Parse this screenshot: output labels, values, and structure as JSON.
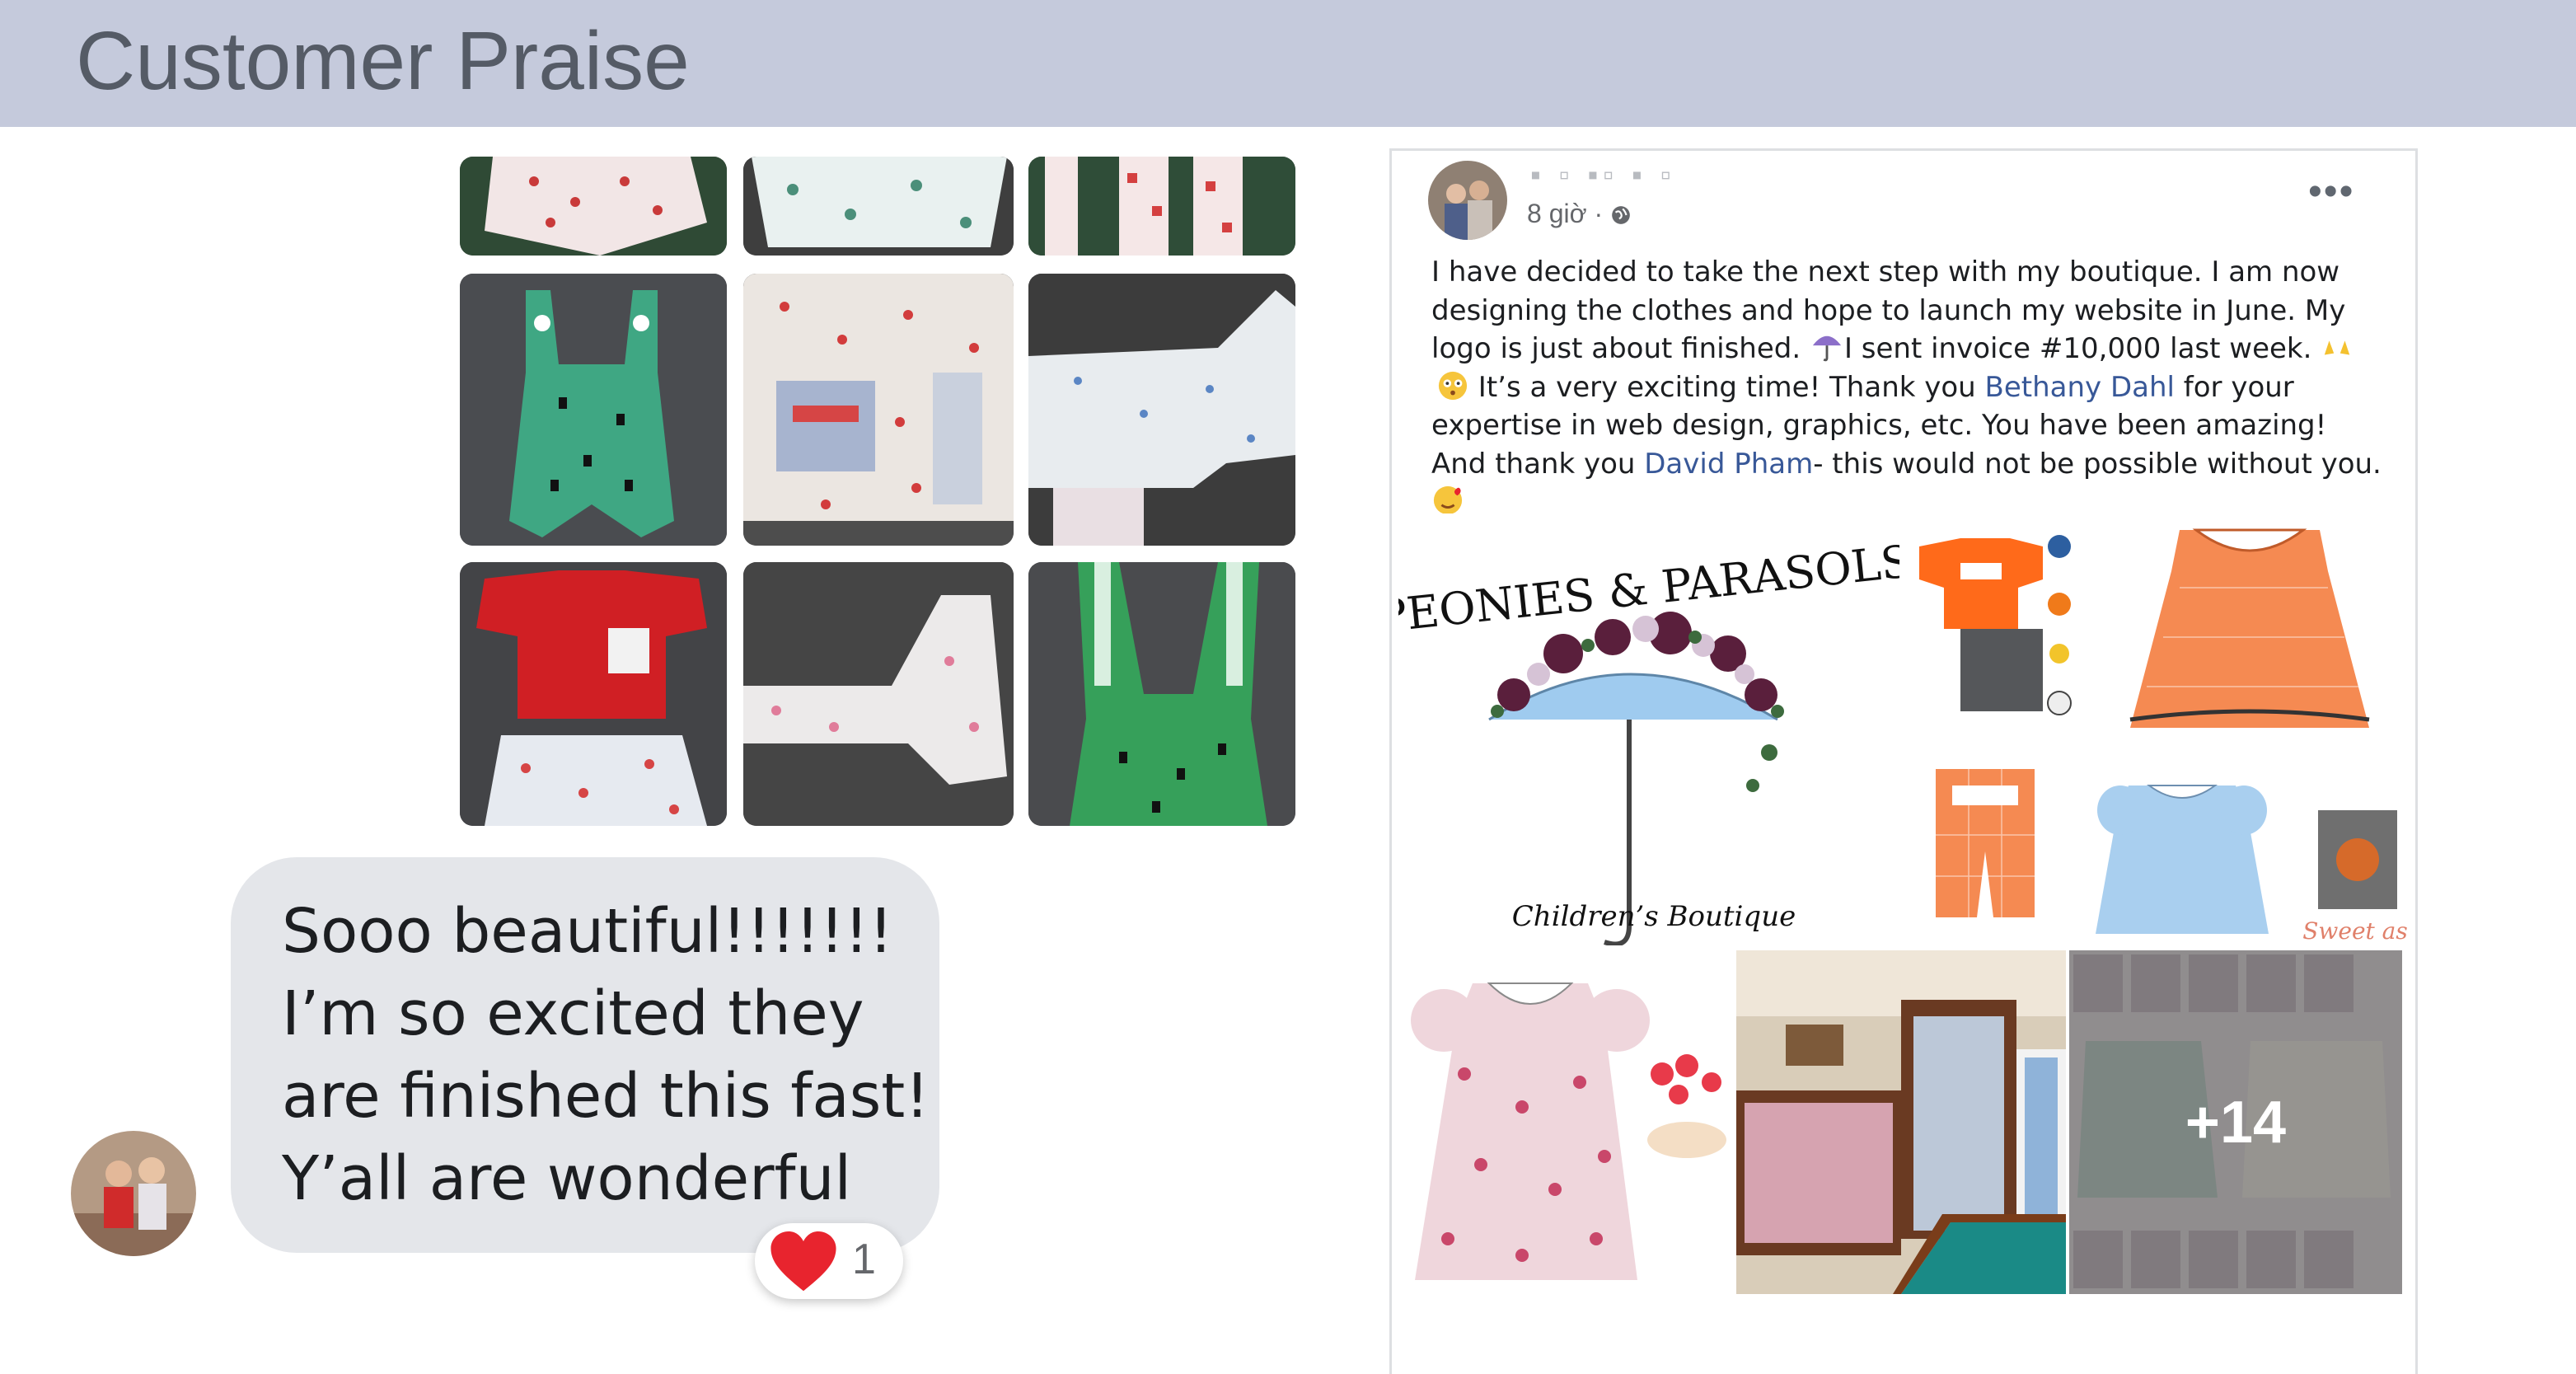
{
  "header": {
    "title": "Customer Praise"
  },
  "comment": {
    "lines": [
      "Sooo beautiful!!!!!!!",
      "I’m so excited they",
      "are finished this fast!",
      "Y’all are wonderful"
    ],
    "reaction": {
      "icon": "heart-icon",
      "count": "1"
    }
  },
  "post": {
    "time": "8 giờ ·",
    "more_label": "•••",
    "body": {
      "part1": "I have decided to take the next step with my boutique. I am now designing the clothes and hope to launch my website in June. My logo is just about finished. ",
      "part2": "I sent invoice #10,000 last week. ",
      "part3": " It’s a very exciting time! Thank you ",
      "mention1": "Bethany Dahl",
      "part4": " for your expertise in web design, graphics, etc. You have been amazing! And thank you ",
      "mention2": "David Pham",
      "part5": "- this would not be possible without you. "
    },
    "images": {
      "logo_line1": "PEONIES & PARASOLS",
      "logo_line2": "Children’s Boutique",
      "sweet_text": "Sweet as",
      "more_photos": "+14"
    }
  },
  "colors": {
    "header_bg": "#c5cadc",
    "bubble_bg": "#e4e6ea",
    "link": "#385898",
    "heart": "#e8242e"
  }
}
